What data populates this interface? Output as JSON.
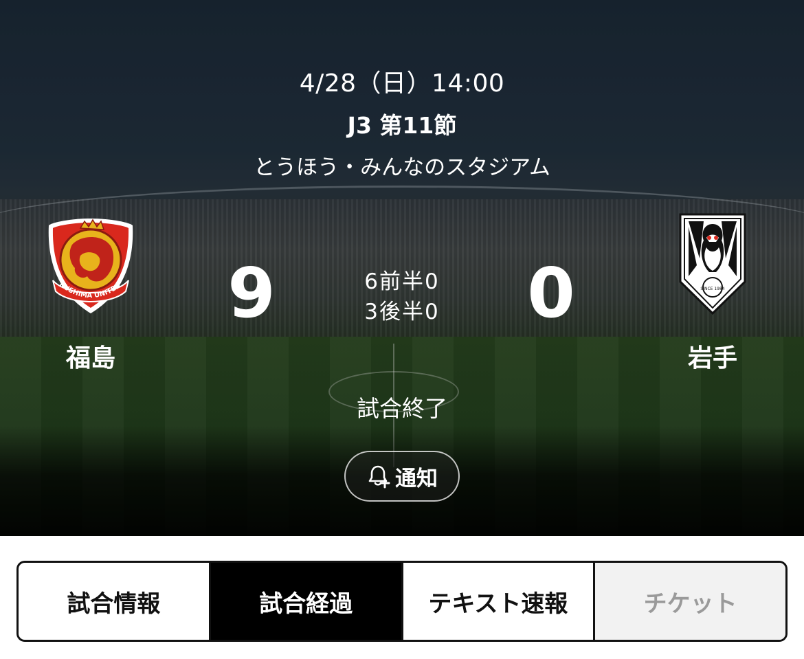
{
  "match": {
    "datetime": "4/28（日）14:00",
    "competition": "J3 第11節",
    "venue": "とうほう・みんなのスタジアム",
    "status": "試合終了"
  },
  "home": {
    "name": "福島",
    "score": "9",
    "logo_icon": "fukushima-united-fc-crest",
    "logo_text": "FUKUSHIMA UNITED FC"
  },
  "away": {
    "name": "岩手",
    "score": "0",
    "logo_icon": "iwate-grulla-crest",
    "logo_text": "SINCE 1984"
  },
  "halves": [
    {
      "home": "6",
      "label": "前半",
      "away": "0"
    },
    {
      "home": "3",
      "label": "後半",
      "away": "0"
    }
  ],
  "notify": {
    "label": "通知",
    "icon": "bell-plus-icon"
  },
  "tabs": [
    {
      "label": "試合情報",
      "state": "normal"
    },
    {
      "label": "試合経過",
      "state": "active"
    },
    {
      "label": "テキスト速報",
      "state": "normal"
    },
    {
      "label": "チケット",
      "state": "disabled"
    }
  ],
  "colors": {
    "tab_active_bg": "#000000",
    "tab_disabled_bg": "#f2f2f2",
    "fukushima_red": "#d9281d",
    "fukushima_gold": "#e8b31c"
  }
}
